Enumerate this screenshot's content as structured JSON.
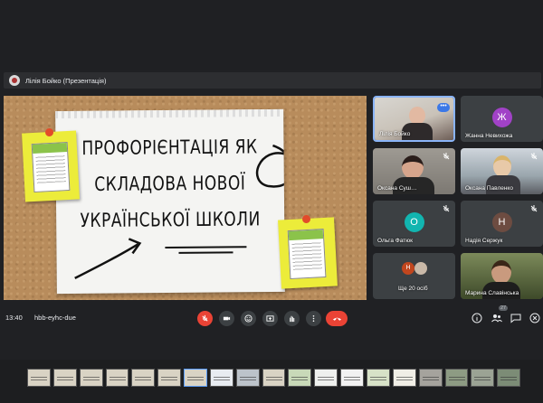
{
  "presentation_bar": {
    "label": "Лілія Бойко (Презентація)"
  },
  "slide": {
    "title_lines": [
      "ПРОФОРІЄНТАЦІЯ ЯК",
      "СКЛАДОВА НОВОЇ",
      "УКРАЇНСЬКОЇ ШКОЛИ"
    ]
  },
  "participants": [
    {
      "name": "Лілія Бойко",
      "type": "photo",
      "more": "•••"
    },
    {
      "name": "Жанна Невихожа",
      "type": "avatar",
      "initial": "Ж",
      "color": "#a142c7"
    },
    {
      "name": "Оксана Суш…",
      "type": "photo"
    },
    {
      "name": "Оксана Павленко",
      "type": "photo"
    },
    {
      "name": "Ольга Фатюк",
      "type": "avatar",
      "initial": "О",
      "color": "#12b5b0"
    },
    {
      "name": "Надія Сержук",
      "type": "avatar",
      "initial": "Н",
      "color": "#6d4c41"
    },
    {
      "name": "Ще 20 осіб",
      "type": "group",
      "initial": "Н",
      "color": "#c1461e"
    },
    {
      "name": "Марина Славінська",
      "type": "photo"
    }
  ],
  "bottom_bar": {
    "time": "13:40",
    "meeting_code": "hbb-eyhc-due",
    "participants_count": "27"
  },
  "colors": {
    "background": "#202124",
    "tile": "#3c4043",
    "danger": "#ea4335",
    "accent": "#3b78e7"
  },
  "icons": [
    "mic-off-icon",
    "camera-icon",
    "emoji-icon",
    "present-icon",
    "hand-icon",
    "more-vert-icon",
    "end-call-icon",
    "info-icon",
    "people-icon",
    "chat-icon",
    "activities-icon"
  ]
}
